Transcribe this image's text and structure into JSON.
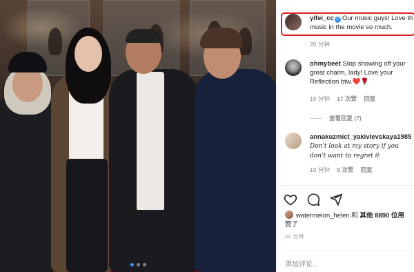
{
  "post": {
    "carousel_dots": 3,
    "active_dot": 0
  },
  "comments": [
    {
      "username": "yifei_cc",
      "verified": true,
      "text_line1": "Our music guys! Love th",
      "text_line2": "music in the movie so much.",
      "time": "20 分钟"
    },
    {
      "username": "ohmybeet",
      "text_line1": "Stop showing off your",
      "text_line2": "great charm, lady! Love your",
      "text_line3": "Reflection btw.",
      "emoji": "❤️🌹",
      "time": "19 分钟",
      "likes": "17 次赞",
      "reply": "回复"
    },
    {
      "username": "annakuzmict_yakivlevskaya1985",
      "text_line1": "Don't look at my story if you",
      "text_line2": "don't want to regret it",
      "time": "19 分钟",
      "likes": "9 次赞",
      "reply": "回复"
    }
  ],
  "view_replies": "查看回复 (7)",
  "likes_line": {
    "user": "watermelon_helen",
    "and": "和",
    "others": "其他 8890 位用",
    "line2": "赞了"
  },
  "time_ago": "20 分钟",
  "add_comment_placeholder": "添加评论..."
}
